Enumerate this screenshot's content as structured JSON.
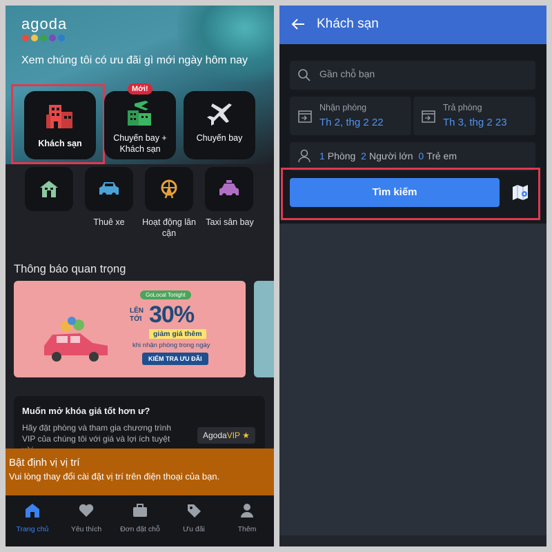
{
  "left": {
    "logo": "agoda",
    "logo_dot_colors": [
      "#e84c3d",
      "#f2c14e",
      "#3aa24b",
      "#7b4bb7",
      "#2e7dd1"
    ],
    "tagline": "Xem chúng tôi có ưu đãi gì mới ngày hôm nay",
    "tiles": {
      "hotel": "Khách sạn",
      "flight_hotel": "Chuyến bay + Khách sạn",
      "flight_hotel_badge": "Mới!",
      "flight": "Chuyến bay"
    },
    "small_tiles": {
      "home": "",
      "car_rental": "Thuê xe",
      "activities": "Hoạt động lân cận",
      "airport_taxi": "Taxi sân bay"
    },
    "announcements_title": "Thông báo quan trọng",
    "promo": {
      "badge": "GoLocal Tonight",
      "prefix": "LÊN TỚI",
      "percent": "30%",
      "discount": "giảm giá thêm",
      "condition": "khi nhận phòng trong ngày",
      "cta": "KIỂM TRA ƯU ĐÃI"
    },
    "vip": {
      "title": "Muốn mở khóa giá tốt hơn ư?",
      "desc": "Hãy đặt phòng và tham gia chương trình VIP của chúng tôi với giá và lợi ích tuyệt vời",
      "btn_prefix": "Agoda",
      "btn_vip": "VIP"
    },
    "location": {
      "title": "Bật định vị vị trí",
      "desc": "Vui lòng thay đổi cài đặt vị trí trên điện thoại của bạn."
    },
    "nav": [
      {
        "label": "Trang chủ",
        "icon": "home-icon"
      },
      {
        "label": "Yêu thích",
        "icon": "heart-icon"
      },
      {
        "label": "Đơn đặt chỗ",
        "icon": "briefcase-icon"
      },
      {
        "label": "Ưu đãi",
        "icon": "tag-icon"
      },
      {
        "label": "Thêm",
        "icon": "person-icon"
      }
    ],
    "accent": "#3b82f0",
    "highlight_color": "#e0394f"
  },
  "right": {
    "title": "Khách sạn",
    "search_placeholder": "Gần chỗ bạn",
    "checkin_label": "Nhận phòng",
    "checkin_value": "Th 2, thg 2 22",
    "checkout_label": "Trả phòng",
    "checkout_value": "Th 3, thg 2 23",
    "rooms_count": "1",
    "rooms_label": "Phòng",
    "adults_count": "2",
    "adults_label": "Người lớn",
    "children_count": "0",
    "children_label": "Trẻ em",
    "search_button": "Tìm kiếm",
    "header_color": "#3a6bd0",
    "button_color": "#3a80ef"
  }
}
